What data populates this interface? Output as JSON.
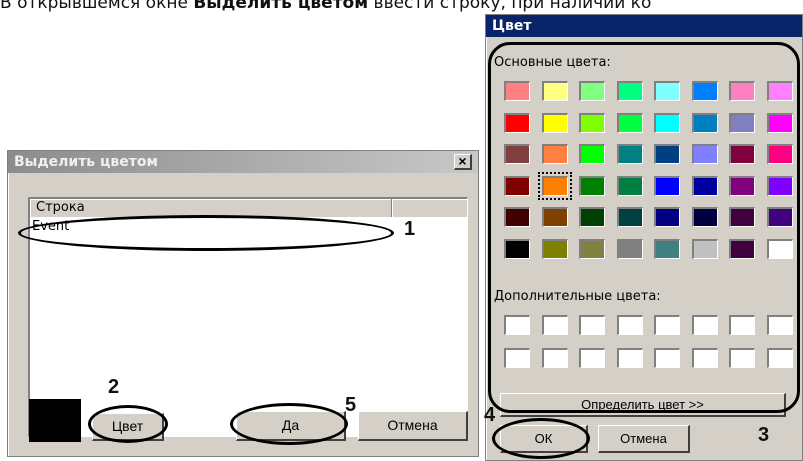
{
  "doc": {
    "line_normal_1": "В открывшемся окне ",
    "line_bold": "Выделить цветом",
    "line_normal_2": " ввести строку, при наличии ко"
  },
  "highlight_dialog": {
    "title": "Выделить цветом",
    "close": "×",
    "column_header": "Строка",
    "rows": [
      "Event"
    ],
    "color_button": "Цвет",
    "ok_button": "Да",
    "cancel_button": "Отмена",
    "current_color": "#000000"
  },
  "color_dialog": {
    "title": "Цвет",
    "basic_colors_label": "Основные цвета:",
    "custom_colors_label": "Дополнительные цвета:",
    "define_button": "Определить цвет >>",
    "ok_button": "ОК",
    "cancel_button": "Отмена",
    "basic_colors": [
      [
        "#ff8080",
        "#ffff80",
        "#80ff80",
        "#00ff80",
        "#80ffff",
        "#0080ff",
        "#ff80c0",
        "#ff80ff"
      ],
      [
        "#ff0000",
        "#ffff00",
        "#80ff00",
        "#00ff40",
        "#00ffff",
        "#0080c0",
        "#8080c0",
        "#ff00ff"
      ],
      [
        "#804040",
        "#ff8040",
        "#00ff00",
        "#008080",
        "#004080",
        "#8080ff",
        "#800040",
        "#ff0080"
      ],
      [
        "#800000",
        "#ff8000",
        "#008000",
        "#008040",
        "#0000ff",
        "#0000a0",
        "#800080",
        "#8000ff"
      ],
      [
        "#400000",
        "#804000",
        "#004000",
        "#004040",
        "#000080",
        "#000040",
        "#400040",
        "#400080"
      ],
      [
        "#000000",
        "#808000",
        "#808040",
        "#808080",
        "#408080",
        "#c0c0c0",
        "#400040",
        "#ffffff"
      ]
    ],
    "selected_color": "#ff8000"
  },
  "annotations": {
    "n1": "1",
    "n2": "2",
    "n3": "3",
    "n4": "4",
    "n5": "5"
  }
}
